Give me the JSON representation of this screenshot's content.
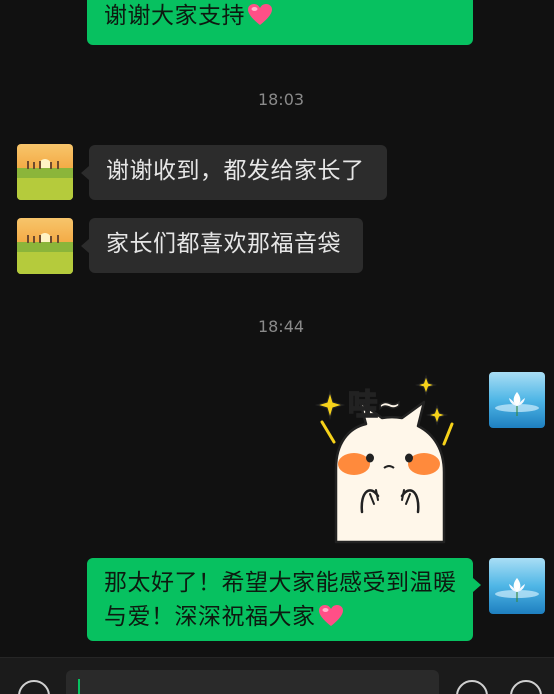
{
  "messages": [
    {
      "id": "m1",
      "direction": "outgoing",
      "text": "谢谢大家支持",
      "emoji": "heart"
    },
    {
      "id": "t1",
      "type": "timestamp",
      "text": "18:03"
    },
    {
      "id": "m2",
      "direction": "incoming",
      "text": "谢谢收到，都发给家长了"
    },
    {
      "id": "m3",
      "direction": "incoming",
      "text": "家长们都喜欢那福音袋"
    },
    {
      "id": "t2",
      "type": "timestamp",
      "text": "18:44"
    },
    {
      "id": "m4",
      "direction": "outgoing",
      "type": "sticker",
      "sticker_text": "哇~"
    },
    {
      "id": "m5",
      "direction": "outgoing",
      "lines": [
        "那太好了！希望大家能感受到温暖",
        "与爱！深深祝福大家"
      ],
      "emoji": "heart"
    }
  ],
  "colors": {
    "background": "#111111",
    "outgoing_bubble": "#07c160",
    "incoming_bubble": "#2c2c2c",
    "timestamp": "#8a8a8a"
  },
  "icons": {
    "voice_toggle": "voice-icon",
    "emoji": "emoji-icon",
    "more": "plus-icon"
  }
}
